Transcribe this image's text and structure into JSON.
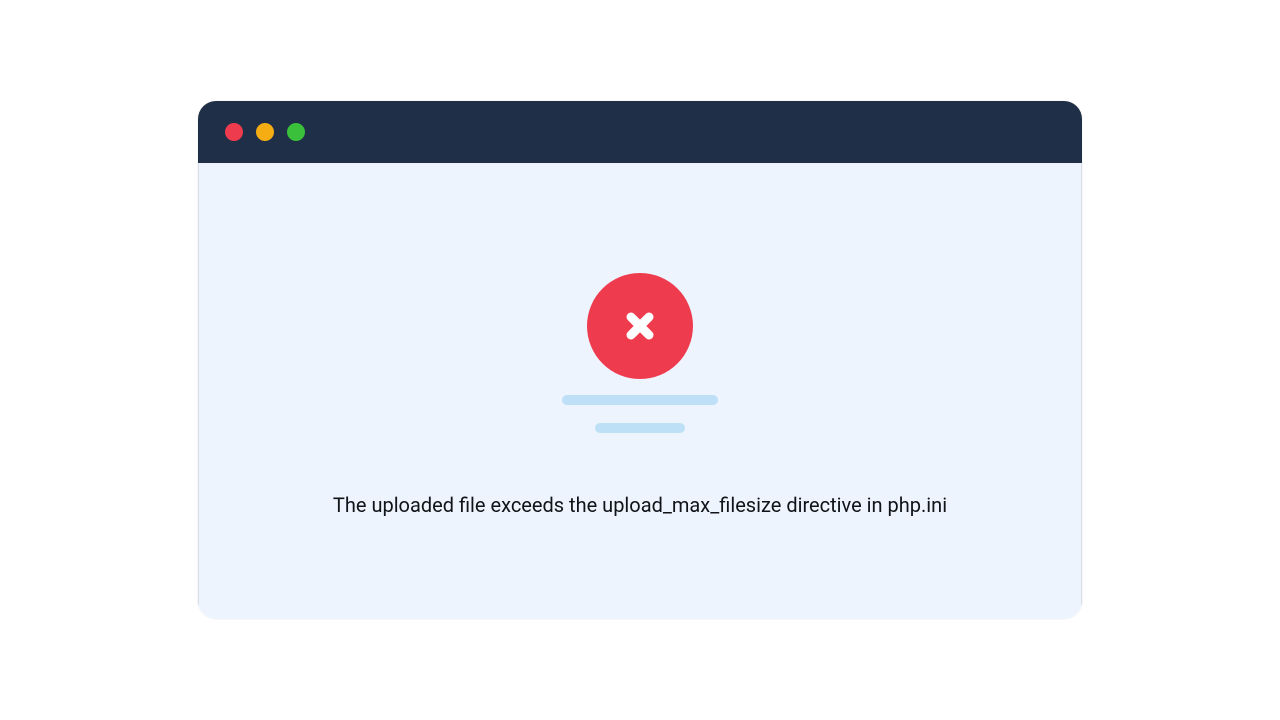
{
  "window": {
    "traffic_lights": {
      "close_color": "#ee3b4e",
      "minimize_color": "#f6ad13",
      "maximize_color": "#3bc03b"
    }
  },
  "error": {
    "icon": "x-circle",
    "message": "The uploaded file exceeds the upload_max_filesize directive in php.ini"
  }
}
